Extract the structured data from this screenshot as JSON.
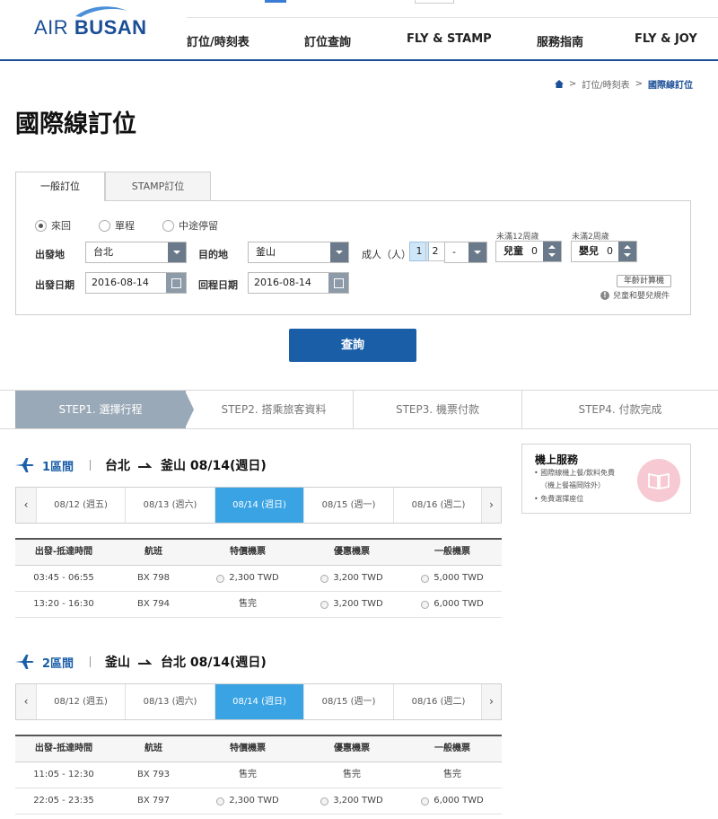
{
  "header": {
    "logo_air": "AIR",
    "logo_busan": "BUSAN",
    "gnb": [
      "訂位/時刻表",
      "訂位查詢",
      "FLY & STAMP",
      "服務指南",
      "FLY & JOY"
    ]
  },
  "breadcrumb": {
    "level1": "訂位/時刻表",
    "current": "國際線訂位"
  },
  "page_title": "國際線訂位",
  "tabs": {
    "active": "一般訂位",
    "inactive": "STAMP訂位"
  },
  "trip_type": {
    "options": [
      "來回",
      "單程",
      "中途停留"
    ],
    "selected": "來回"
  },
  "form": {
    "origin_label": "出發地",
    "origin": "台北",
    "dest_label": "目的地",
    "dest": "釜山",
    "adult_label": "成人（人）",
    "adult_options": [
      "1",
      "2",
      "-"
    ],
    "adult_selected": "1",
    "child_hint": "未滿12周歲",
    "child_label": "兒童",
    "child_count": "0",
    "infant_hint": "未滿2周歲",
    "infant_label": "嬰兒",
    "infant_count": "0",
    "depart_label": "出發日期",
    "depart_date": "2016-08-14",
    "return_label": "回程日期",
    "return_date": "2016-08-14",
    "age_calc": "年齡計算機",
    "note": "兒童和嬰兒規件"
  },
  "search_button": "查詢",
  "steps": [
    "STEP1. 選擇行程",
    "STEP2. 搭乘旅客資料",
    "STEP3. 機票付款",
    "STEP4. 付款完成"
  ],
  "columns": [
    "出發-抵達時間",
    "航班",
    "特價機票",
    "優惠機票",
    "一般機票"
  ],
  "segments": [
    {
      "no": "1區間",
      "from": "台北",
      "to": "釜山 08/14(週日)",
      "dates": [
        "08/12 (週五)",
        "08/13 (週六)",
        "08/14 (週日)",
        "08/15 (週一)",
        "08/16 (週二)"
      ],
      "selected_index": 2,
      "flights": [
        {
          "time": "03:45 - 06:55",
          "flight": "BX 798",
          "fares": [
            {
              "text": "2,300 TWD",
              "radio": true
            },
            {
              "text": "3,200 TWD",
              "radio": true
            },
            {
              "text": "5,000 TWD",
              "radio": true
            }
          ]
        },
        {
          "time": "13:20 - 16:30",
          "flight": "BX 794",
          "fares": [
            {
              "text": "售完",
              "radio": false
            },
            {
              "text": "3,200 TWD",
              "radio": true
            },
            {
              "text": "6,000 TWD",
              "radio": true
            }
          ]
        }
      ]
    },
    {
      "no": "2區間",
      "from": "釜山",
      "to": "台北 08/14(週日)",
      "dates": [
        "08/12 (週五)",
        "08/13 (週六)",
        "08/14 (週日)",
        "08/15 (週一)",
        "08/16 (週二)"
      ],
      "selected_index": 2,
      "flights": [
        {
          "time": "11:05 - 12:30",
          "flight": "BX 793",
          "fares": [
            {
              "text": "售完",
              "radio": false
            },
            {
              "text": "售完",
              "radio": false
            },
            {
              "text": "售完",
              "radio": false
            }
          ]
        },
        {
          "time": "22:05 - 23:35",
          "flight": "BX 797",
          "fares": [
            {
              "text": "2,300 TWD",
              "radio": true
            },
            {
              "text": "3,200 TWD",
              "radio": true
            },
            {
              "text": "6,000 TWD",
              "radio": true
            }
          ]
        }
      ]
    }
  ],
  "side": {
    "title": "機上服務",
    "lines": [
      "國際線機上餐/飲料免費",
      "（機上餐福岡除外）",
      "免費選擇座位"
    ]
  },
  "colors": {
    "brand": "#1a4e96",
    "accent": "#39a3e3",
    "button": "#1a5ea8",
    "step_active": "#9aa9b7"
  }
}
